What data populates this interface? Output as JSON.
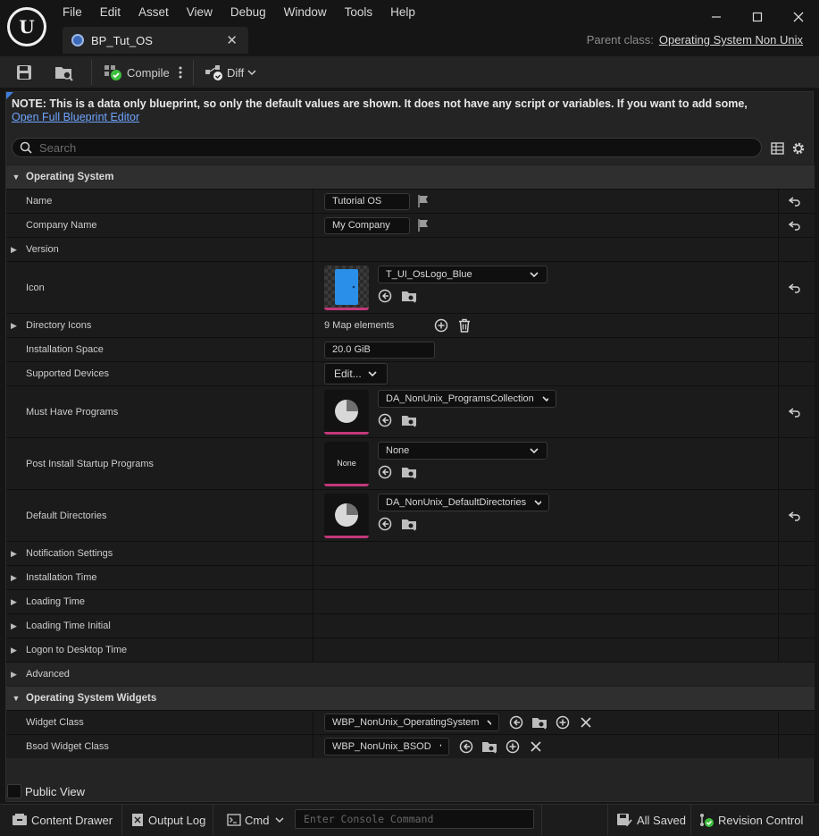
{
  "app": {
    "menu": [
      "File",
      "Edit",
      "Asset",
      "View",
      "Debug",
      "Window",
      "Tools",
      "Help"
    ],
    "tab_title": "BP_Tut_OS",
    "parent_class_label": "Parent class:",
    "parent_class_value": "Operating System Non Unix"
  },
  "toolbar": {
    "compile_label": "Compile",
    "diff_label": "Diff"
  },
  "note": {
    "text": "NOTE: This is a data only blueprint, so only the default values are shown.  It does not have any script or variables.  If you want to add some,",
    "link": "Open Full Blueprint Editor"
  },
  "search": {
    "placeholder": "Search"
  },
  "categories": {
    "os": "Operating System",
    "widgets": "Operating System Widgets"
  },
  "props": {
    "name": {
      "label": "Name",
      "value": "Tutorial OS"
    },
    "company": {
      "label": "Company Name",
      "value": "My Company"
    },
    "version": {
      "label": "Version"
    },
    "icon": {
      "label": "Icon",
      "value": "T_UI_OsLogo_Blue"
    },
    "dir_icons": {
      "label": "Directory Icons",
      "value": "9 Map elements"
    },
    "install_space": {
      "label": "Installation Space",
      "value": "20.0 GiB"
    },
    "supported_devices": {
      "label": "Supported Devices",
      "value": "Edit..."
    },
    "must_have": {
      "label": "Must Have Programs",
      "value": "DA_NonUnix_ProgramsCollection"
    },
    "post_install": {
      "label": "Post Install Startup Programs",
      "value": "None",
      "thumb": "None"
    },
    "default_dirs": {
      "label": "Default Directories",
      "value": "DA_NonUnix_DefaultDirectories"
    },
    "notification": {
      "label": "Notification Settings"
    },
    "install_time": {
      "label": "Installation Time"
    },
    "loading_time": {
      "label": "Loading Time"
    },
    "loading_time_initial": {
      "label": "Loading Time Initial"
    },
    "logon_time": {
      "label": "Logon to Desktop Time"
    },
    "advanced": {
      "label": "Advanced"
    },
    "widget_class": {
      "label": "Widget Class",
      "value": "WBP_NonUnix_OperatingSystem"
    },
    "bsod_class": {
      "label": "Bsod Widget Class",
      "value": "WBP_NonUnix_BSOD"
    }
  },
  "public_view": "Public View",
  "status": {
    "content_drawer": "Content Drawer",
    "output_log": "Output Log",
    "cmd": "Cmd",
    "console_placeholder": "Enter Console Command",
    "all_saved": "All Saved",
    "revision_control": "Revision Control"
  },
  "colors": {
    "accent_link": "#6fa5ff",
    "asset_underline": "#c2387a",
    "compile_ok": "#3fbf3f"
  }
}
